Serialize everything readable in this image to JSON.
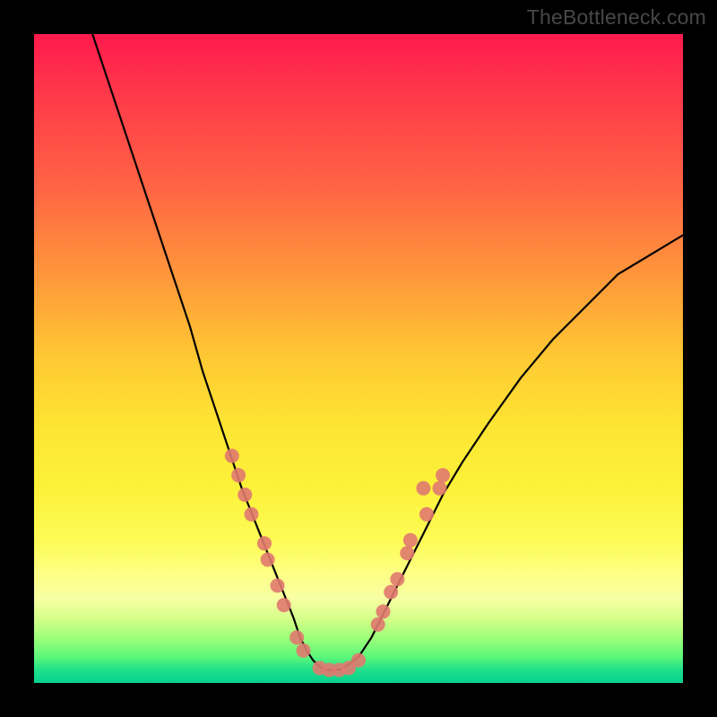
{
  "watermark": "TheBottleneck.com",
  "colors": {
    "curve_stroke": "#000000",
    "marker_fill": "#e0796f",
    "marker_stroke": "#c9655c"
  },
  "chart_data": {
    "type": "line",
    "title": "",
    "xlabel": "",
    "ylabel": "",
    "xlim": [
      0,
      100
    ],
    "ylim": [
      0,
      100
    ],
    "curve": {
      "x": [
        9,
        12,
        15,
        18,
        21,
        24,
        26,
        28,
        30,
        32,
        34,
        36,
        38,
        40,
        41,
        42,
        43,
        44,
        45,
        46,
        47,
        48,
        50,
        52,
        54,
        56,
        58,
        60,
        63,
        66,
        70,
        75,
        80,
        85,
        90,
        95,
        100
      ],
      "y": [
        100,
        91,
        82,
        73,
        64,
        55,
        48,
        42,
        36,
        30,
        25,
        20,
        15,
        10,
        7,
        5,
        3.5,
        2.5,
        2,
        2,
        2,
        2.5,
        4,
        7,
        11,
        15,
        19,
        23,
        29,
        34,
        40,
        47,
        53,
        58,
        63,
        66,
        69
      ]
    },
    "markers": [
      {
        "x": 30.5,
        "y": 35
      },
      {
        "x": 31.5,
        "y": 32
      },
      {
        "x": 32.5,
        "y": 29
      },
      {
        "x": 33.5,
        "y": 26
      },
      {
        "x": 35.5,
        "y": 21.5
      },
      {
        "x": 36.0,
        "y": 19
      },
      {
        "x": 37.5,
        "y": 15
      },
      {
        "x": 38.5,
        "y": 12
      },
      {
        "x": 40.5,
        "y": 7
      },
      {
        "x": 41.5,
        "y": 5
      },
      {
        "x": 44.0,
        "y": 2.3
      },
      {
        "x": 45.5,
        "y": 2
      },
      {
        "x": 47.0,
        "y": 2
      },
      {
        "x": 48.5,
        "y": 2.3
      },
      {
        "x": 50.0,
        "y": 3.5
      },
      {
        "x": 53.0,
        "y": 9
      },
      {
        "x": 53.8,
        "y": 11
      },
      {
        "x": 55.0,
        "y": 14
      },
      {
        "x": 56.0,
        "y": 16
      },
      {
        "x": 57.5,
        "y": 20
      },
      {
        "x": 58.0,
        "y": 22
      },
      {
        "x": 60.5,
        "y": 26
      },
      {
        "x": 60.0,
        "y": 30
      },
      {
        "x": 62.5,
        "y": 30
      },
      {
        "x": 63.0,
        "y": 32
      }
    ]
  }
}
